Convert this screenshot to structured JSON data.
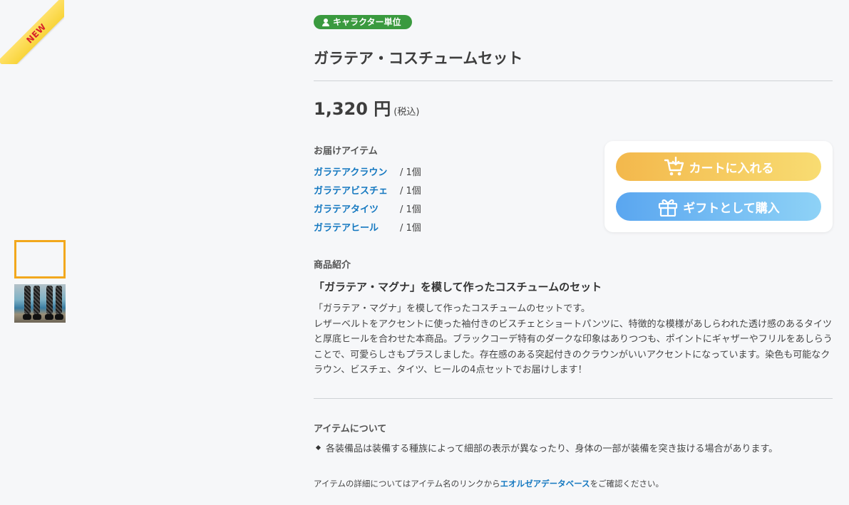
{
  "ribbon": {
    "label": "NEW"
  },
  "badge": {
    "label": "キャラクター単位"
  },
  "product": {
    "title": "ガラテア・コスチュームセット",
    "price": "1,320 円",
    "tax_note": "(税込)"
  },
  "delivery": {
    "label": "お届けアイテム",
    "items": [
      {
        "name": "ガラテアクラウン",
        "qty": "/ 1個"
      },
      {
        "name": "ガラテアビスチェ",
        "qty": "/ 1個"
      },
      {
        "name": "ガラテアタイツ",
        "qty": "/ 1個"
      },
      {
        "name": "ガラテアヒール",
        "qty": "/ 1個"
      }
    ]
  },
  "actions": {
    "cart_label": "カートに入れる",
    "gift_label": "ギフトとして購入"
  },
  "intro": {
    "label": "商品紹介",
    "headline": "「ガラテア・マグナ」を模して作ったコスチュームのセット",
    "lines": [
      "「ガラテア・マグナ」を模して作ったコスチュームのセットです。",
      "レザーベルトをアクセントに使った袖付きのビスチェとショートパンツに、特徴的な模様があしらわれた透け感のあるタイツと厚底ヒールを合わせた本商品。ブラックコーデ特有のダークな印象はありつつも、ポイントにギャザーやフリルをあしらうことで、可愛らしさもプラスしました。存在感のある突起付きのクラウンがいいアクセントになっています。染色も可能なクラウン、ビスチェ、タイツ、ヒールの4点セットでお届けします！"
    ]
  },
  "about": {
    "label": "アイテムについて",
    "note": "各装備品は装備する種族によって細部の表示が異なったり、身体の一部が装備を突き抜ける場合があります。"
  },
  "footer": {
    "prefix": "アイテムの詳細についてはアイテム名のリンクから",
    "link": "エオルゼアデータベース",
    "suffix": "をご確認ください。"
  },
  "colors": {
    "badge": "#3a9a3f",
    "link": "#1478c0",
    "cart_button": "#f3b84c",
    "gift_button": "#5aa6f0",
    "selected_thumb": "#f2a81d"
  }
}
